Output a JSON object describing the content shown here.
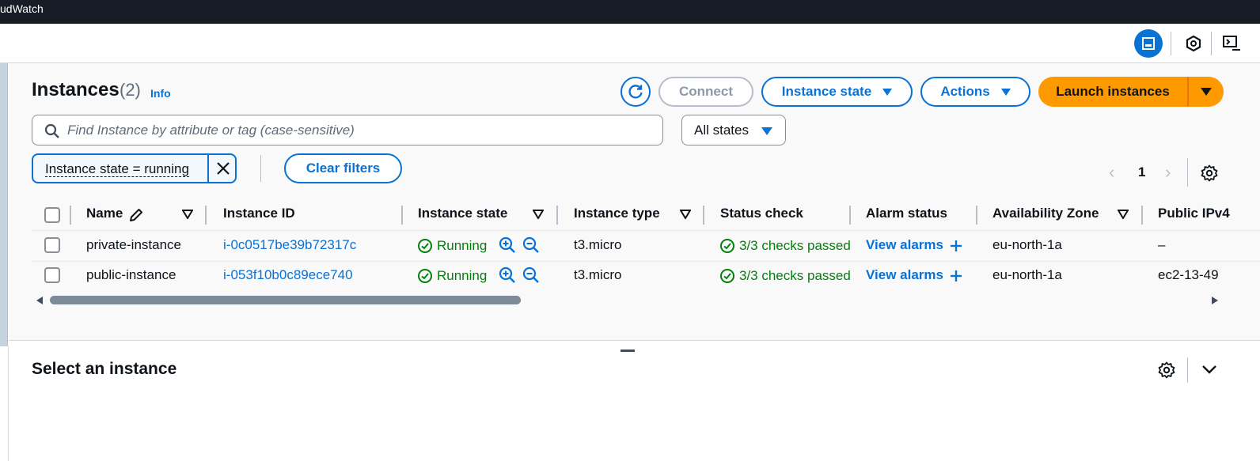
{
  "topbar": {
    "title": "udWatch"
  },
  "page": {
    "title": "Instances",
    "count": "(2)",
    "info_label": "Info"
  },
  "toolbar": {
    "connect_label": "Connect",
    "instance_state_label": "Instance state",
    "actions_label": "Actions",
    "launch_label": "Launch instances"
  },
  "search": {
    "placeholder": "Find Instance by attribute or tag (case-sensitive)",
    "value": ""
  },
  "state_filter": {
    "selected": "All states"
  },
  "filter_token": {
    "label": "Instance state = running"
  },
  "clear_filters_label": "Clear filters",
  "pagination": {
    "current_page": "1"
  },
  "table": {
    "columns": [
      "Name",
      "Instance ID",
      "Instance state",
      "Instance type",
      "Status check",
      "Alarm status",
      "Availability Zone",
      "Public IPv4"
    ],
    "rows": [
      {
        "name": "private-instance",
        "instance_id": "i-0c0517be39b72317c",
        "state": "Running",
        "type": "t3.micro",
        "status_check": "3/3 checks passed",
        "alarm": "View alarms",
        "az": "eu-north-1a",
        "public_ip": "–"
      },
      {
        "name": "public-instance",
        "instance_id": "i-053f10b0c89ece740",
        "state": "Running",
        "type": "t3.micro",
        "status_check": "3/3 checks passed",
        "alarm": "View alarms",
        "az": "eu-north-1a",
        "public_ip": "ec2-13-49"
      }
    ]
  },
  "details": {
    "title": "Select an instance"
  },
  "colors": {
    "accent": "#0972d3",
    "launch": "#ff9900",
    "success": "#037f0c",
    "topbar": "#161d26"
  }
}
